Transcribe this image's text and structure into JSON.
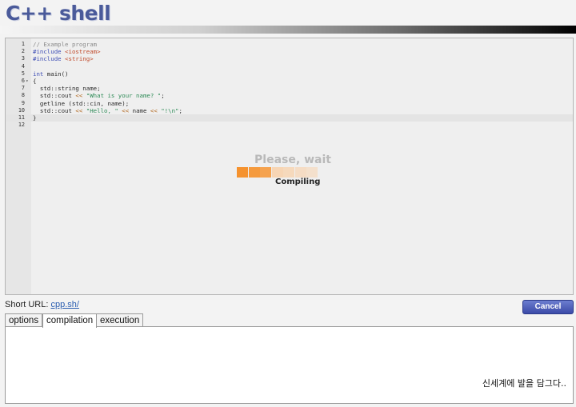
{
  "app": {
    "title": "C++ shell"
  },
  "editor": {
    "lines": [
      {
        "num": "1",
        "tokens": [
          {
            "t": "// Example program",
            "c": "c"
          }
        ]
      },
      {
        "num": "2",
        "tokens": [
          {
            "t": "#include ",
            "c": "p"
          },
          {
            "t": "<iostream>",
            "c": "s"
          }
        ]
      },
      {
        "num": "3",
        "tokens": [
          {
            "t": "#include ",
            "c": "p"
          },
          {
            "t": "<string>",
            "c": "s"
          }
        ]
      },
      {
        "num": "4",
        "tokens": []
      },
      {
        "num": "5",
        "tokens": [
          {
            "t": "int",
            "c": "k"
          },
          {
            "t": " main()",
            "c": ""
          }
        ]
      },
      {
        "num": "6",
        "fold": true,
        "tokens": [
          {
            "t": "{",
            "c": ""
          }
        ]
      },
      {
        "num": "7",
        "tokens": [
          {
            "t": "  std::string name;",
            "c": ""
          }
        ]
      },
      {
        "num": "8",
        "tokens": [
          {
            "t": "  std::cout ",
            "c": ""
          },
          {
            "t": "<<",
            "c": "o"
          },
          {
            "t": " ",
            "c": ""
          },
          {
            "t": "\"What is your name? \"",
            "c": "str"
          },
          {
            "t": ";",
            "c": ""
          }
        ]
      },
      {
        "num": "9",
        "tokens": [
          {
            "t": "  getline (std::cin, name);",
            "c": ""
          }
        ]
      },
      {
        "num": "10",
        "tokens": [
          {
            "t": "  std::cout ",
            "c": ""
          },
          {
            "t": "<<",
            "c": "o"
          },
          {
            "t": " ",
            "c": ""
          },
          {
            "t": "\"Hello, \"",
            "c": "str"
          },
          {
            "t": " ",
            "c": ""
          },
          {
            "t": "<<",
            "c": "o"
          },
          {
            "t": " name ",
            "c": ""
          },
          {
            "t": "<<",
            "c": "o"
          },
          {
            "t": " ",
            "c": ""
          },
          {
            "t": "\"!\\n\"",
            "c": "str"
          },
          {
            "t": ";",
            "c": ""
          }
        ]
      },
      {
        "num": "11",
        "active": true,
        "tokens": [
          {
            "t": "}",
            "c": ""
          }
        ]
      },
      {
        "num": "12",
        "tokens": []
      }
    ]
  },
  "overlay": {
    "title": "Please, wait",
    "status": "Compiling",
    "progress_segments": 7,
    "progress_filled": 3,
    "colors": {
      "filled": "#f5922e",
      "empty": "#f7d2ad"
    }
  },
  "short_url": {
    "label": "Short URL:",
    "link": "cpp.sh/"
  },
  "cancel_label": "Cancel",
  "tabs": [
    {
      "label": "options",
      "active": false
    },
    {
      "label": "compilation",
      "active": true
    },
    {
      "label": "execution",
      "active": false
    }
  ],
  "output_caption": "신세계에 발을 담그다.."
}
